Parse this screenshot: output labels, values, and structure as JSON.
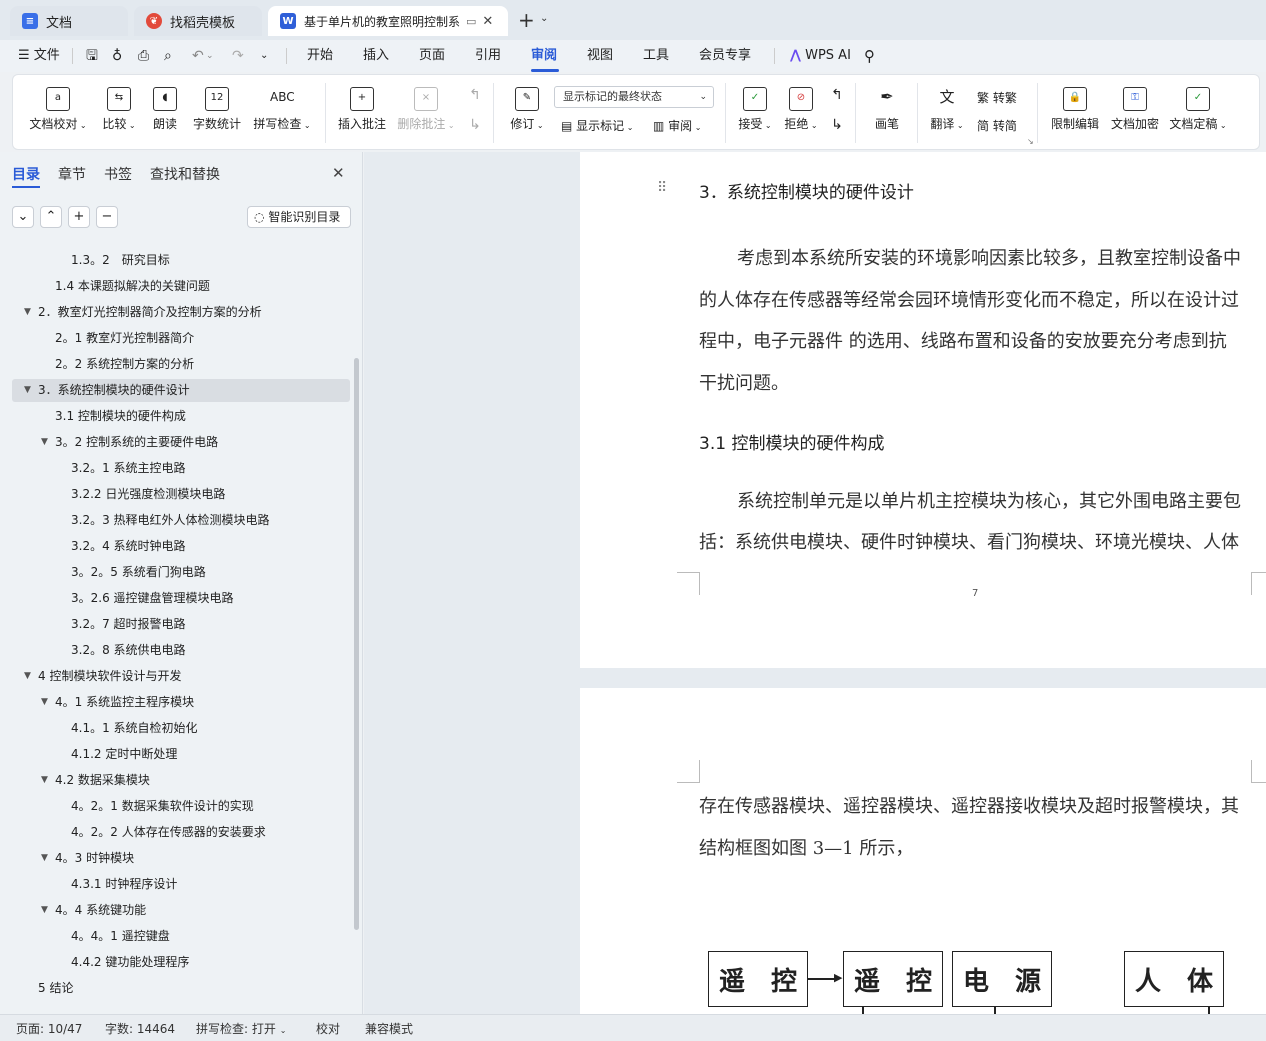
{
  "tabs": [
    {
      "label": "文档",
      "icon": "docs-app-icon"
    },
    {
      "label": "找稻壳模板",
      "icon": "docer-icon"
    },
    {
      "label": "基于单片机的教室照明控制系",
      "icon": "word-doc-icon"
    }
  ],
  "menu": {
    "file": "文件",
    "items": [
      "开始",
      "插入",
      "页面",
      "引用",
      "审阅",
      "视图",
      "工具",
      "会员专享"
    ],
    "active": "审阅",
    "wps_ai": "WPS AI"
  },
  "ribbon": {
    "proofread": "文档校对",
    "compare": "比较",
    "read_aloud": "朗读",
    "word_count": "字数统计",
    "word_count_icon_text": "12",
    "spell_check": "拼写检查",
    "spell_icon_text": "ABC",
    "insert_comment": "插入批注",
    "delete_comment": "删除批注",
    "track_changes": "修订",
    "markup_state": "显示标记的最终状态",
    "show_markup": "显示标记",
    "review_pane": "审阅",
    "accept": "接受",
    "reject": "拒绝",
    "ink": "画笔",
    "translate": "翻译",
    "to_traditional": "转繁",
    "to_simplified": "转简",
    "restrict_edit": "限制编辑",
    "encrypt": "文档加密",
    "finalize": "文档定稿"
  },
  "sidebar": {
    "tabs": [
      "目录",
      "章节",
      "书签",
      "查找和替换"
    ],
    "active_tab": "目录",
    "smart_toc": "智能识别目录",
    "toc": [
      {
        "text": "1.3。2　研究目标",
        "level": 3,
        "arrow": false
      },
      {
        "text": "1.4  本课题拟解决的关键问题",
        "level": 2,
        "arrow": false
      },
      {
        "text": "2．教室灯光控制器简介及控制方案的分析",
        "level": 1,
        "arrow": true
      },
      {
        "text": "2。1  教室灯光控制器简介",
        "level": 2,
        "arrow": false
      },
      {
        "text": "2。2  系统控制方案的分析",
        "level": 2,
        "arrow": false
      },
      {
        "text": "3．系统控制模块的硬件设计",
        "level": 1,
        "arrow": true,
        "selected": true
      },
      {
        "text": "3.1  控制模块的硬件构成",
        "level": 2,
        "arrow": false
      },
      {
        "text": "3。2  控制系统的主要硬件电路",
        "level": 2,
        "arrow": true
      },
      {
        "text": "3.2。1  系统主控电路",
        "level": 3,
        "arrow": false
      },
      {
        "text": "3.2.2  日光强度检测模块电路",
        "level": 3,
        "arrow": false
      },
      {
        "text": "3.2。3  热释电红外人体检测模块电路",
        "level": 3,
        "arrow": false
      },
      {
        "text": "3.2。4  系统时钟电路",
        "level": 3,
        "arrow": false
      },
      {
        "text": "3。2。5 系统看门狗电路",
        "level": 3,
        "arrow": false
      },
      {
        "text": "3。2.6  遥控键盘管理模块电路",
        "level": 3,
        "arrow": false
      },
      {
        "text": "3.2。7  超时报警电路",
        "level": 3,
        "arrow": false
      },
      {
        "text": "3.2。8  系统供电电路",
        "level": 3,
        "arrow": false
      },
      {
        "text": "4  控制模块软件设计与开发",
        "level": 1,
        "arrow": true
      },
      {
        "text": "4。1  系统监控主程序模块",
        "level": 2,
        "arrow": true
      },
      {
        "text": "4.1。1 系统自检初始化",
        "level": 3,
        "arrow": false
      },
      {
        "text": "4.1.2  定时中断处理",
        "level": 3,
        "arrow": false
      },
      {
        "text": "4.2  数据采集模块",
        "level": 2,
        "arrow": true
      },
      {
        "text": "4。2。1  数据采集软件设计的实现",
        "level": 3,
        "arrow": false
      },
      {
        "text": "4。2。2  人体存在传感器的安装要求",
        "level": 3,
        "arrow": false
      },
      {
        "text": "4。3  时钟模块",
        "level": 2,
        "arrow": true
      },
      {
        "text": "4.3.1 时钟程序设计",
        "level": 3,
        "arrow": false
      },
      {
        "text": "4。4  系统键功能",
        "level": 2,
        "arrow": true
      },
      {
        "text": "4。4。1  遥控键盘",
        "level": 3,
        "arrow": false
      },
      {
        "text": "4.4.2  键功能处理程序",
        "level": 3,
        "arrow": false
      },
      {
        "text": "5  结论",
        "level": 1,
        "arrow": false
      }
    ]
  },
  "document": {
    "heading1": "3．系统控制模块的硬件设计",
    "para1": [
      "考虑到本系统所安装的环境影响因素比较多，且教室控制设备中",
      "的人体存在传感器等经常会园环境情形变化而不稳定，所以在设计过",
      "程中，电子元器件  的选用、线路布置和设备的安放要充分考虑到抗",
      "干扰问题。"
    ],
    "heading2": "3.1  控制模块的硬件构成",
    "para2": [
      "系统控制单元是以单片机主控模块为核心，其它外围电路主要包",
      "括：系统供电模块、硬件时钟模块、看门狗模块、环境光模块、人体"
    ],
    "page_number": "7",
    "para3": [
      "存在传感器模块、遥控器模块、遥控器接收模块及超时报警模块，其",
      "结构框图如图 3—1 所示，"
    ],
    "diagram_boxes": [
      [
        "遥",
        "控"
      ],
      [
        "遥",
        "控"
      ],
      [
        "电",
        "源"
      ],
      [
        "人",
        "体"
      ]
    ]
  },
  "status": {
    "page": "页面: 10/47",
    "words": "字数: 14464",
    "spell": "拼写检查: 打开",
    "proof": "校对",
    "compat": "兼容模式"
  }
}
